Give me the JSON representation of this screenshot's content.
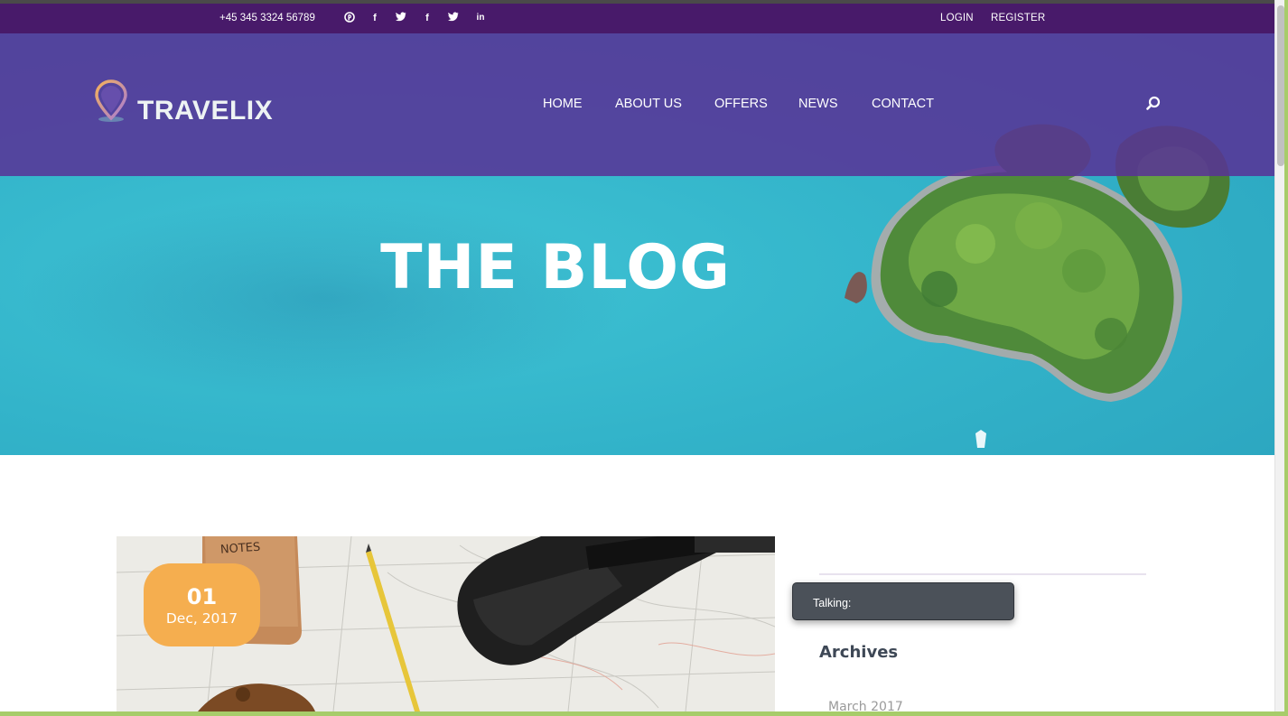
{
  "topbar": {
    "phone": "+45 345 3324 56789",
    "social_icons": [
      "pinterest-icon",
      "facebook-icon",
      "twitter-icon",
      "facebook-icon",
      "twitter-icon",
      "linkedin-icon"
    ],
    "login": "LOGIN",
    "register": "REGISTER"
  },
  "header": {
    "logo": "TRAVELIX",
    "nav": [
      "HOME",
      "ABOUT US",
      "OFFERS",
      "NEWS",
      "CONTACT"
    ]
  },
  "hero": {
    "title": "THE BLOG"
  },
  "post": {
    "day": "01",
    "month_year": "Dec, 2017"
  },
  "sidebar": {
    "tooltip": "Talking:",
    "archives_title": "Archives",
    "archive_items": [
      "March 2017"
    ]
  },
  "colors": {
    "topbar": "#481a6a",
    "header_overlay": "#5832968c",
    "badge": "#f5ae4f",
    "ocean": "#33b4ca"
  }
}
